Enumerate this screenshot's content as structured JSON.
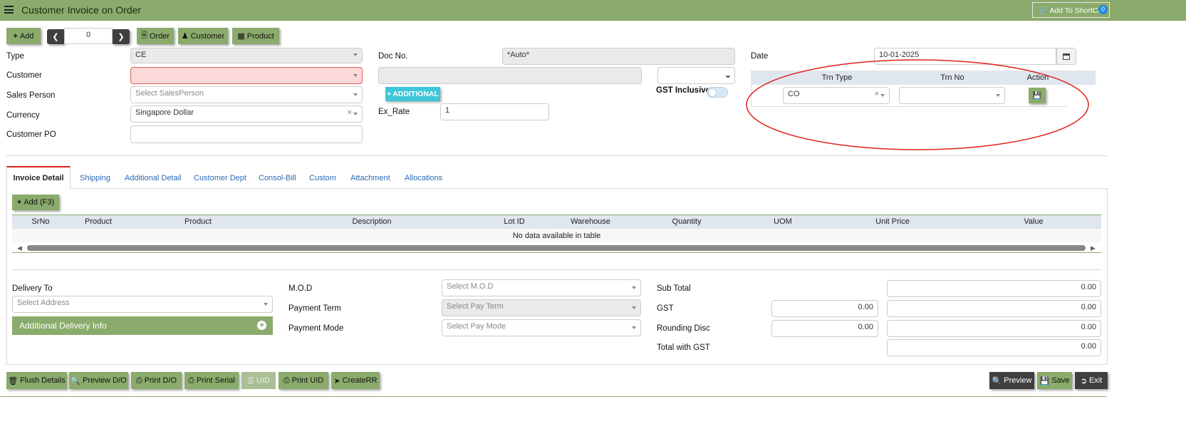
{
  "header": {
    "title": "Customer Invoice on Order",
    "shortcut_label": "Add To ShortCut",
    "shortcut_count": "0"
  },
  "toolbar": {
    "add": "Add",
    "record_no": "0",
    "order": "Order",
    "customer": "Customer",
    "product": "Product"
  },
  "form": {
    "type_label": "Type",
    "type_value": "CE",
    "customer_label": "Customer",
    "salesperson_label": "Sales Person",
    "salesperson_placeholder": "Select SalesPerson",
    "currency_label": "Currency",
    "currency_value": "Singapore Dollar",
    "customer_po_label": "Customer PO",
    "docno_label": "Doc No.",
    "docno_value": "*Auto*",
    "additional_button": "ADDITIONAL",
    "gst_inclusive_label": "GST Inclusive",
    "exrate_label": "Ex_Rate",
    "exrate_value": "1",
    "date_label": "Date",
    "date_value": "10-01-2025"
  },
  "trn": {
    "col_type": "Trn Type",
    "col_no": "Trn No",
    "col_action": "Action",
    "type_value": "CO"
  },
  "tabs": [
    "Invoice Detail",
    "Shipping",
    "Additional Detail",
    "Customer Dept",
    "Consol-Bill",
    "Custom",
    "Attachment",
    "Allocations"
  ],
  "detail": {
    "add_button": "Add (F3)",
    "columns": [
      "SrNo",
      "Product",
      "Product",
      "Description",
      "Lot ID",
      "Warehouse",
      "Quantity",
      "UOM",
      "Unit Price",
      "Value"
    ],
    "empty_message": "No data available in table"
  },
  "footer": {
    "delivery_to_label": "Delivery To",
    "address_placeholder": "Select Address",
    "additional_delivery": "Additional Delivery Info",
    "mod_label": "M.O.D",
    "mod_placeholder": "Select M.O.D",
    "payterm_label": "Payment Term",
    "payterm_placeholder": "Select Pay Term",
    "paymode_label": "Payment Mode",
    "paymode_placeholder": "Select Pay Mode",
    "subtotal_label": "Sub Total",
    "subtotal_value": "0.00",
    "gst_label": "GST",
    "gst_rate": "0.00",
    "gst_value": "0.00",
    "rounding_label": "Rounding Disc",
    "rounding_rate": "0.00",
    "rounding_value": "0.00",
    "total_label": "Total with GST",
    "total_value": "0.00"
  },
  "actions": {
    "flush": "Flush Details",
    "preview_do": "Preview D/O",
    "print_do": "Print D/O",
    "print_serial": "Print Serial",
    "uid": "UID",
    "print_uid": "Print UID",
    "create_rr": "CreateRR",
    "preview": "Preview",
    "save": "Save",
    "exit": "Exit"
  },
  "colors": {
    "accent": "#8aab6b",
    "info": "#3ec6d9",
    "error_bg": "#fbd9d9",
    "highlight": "#e0201a"
  }
}
